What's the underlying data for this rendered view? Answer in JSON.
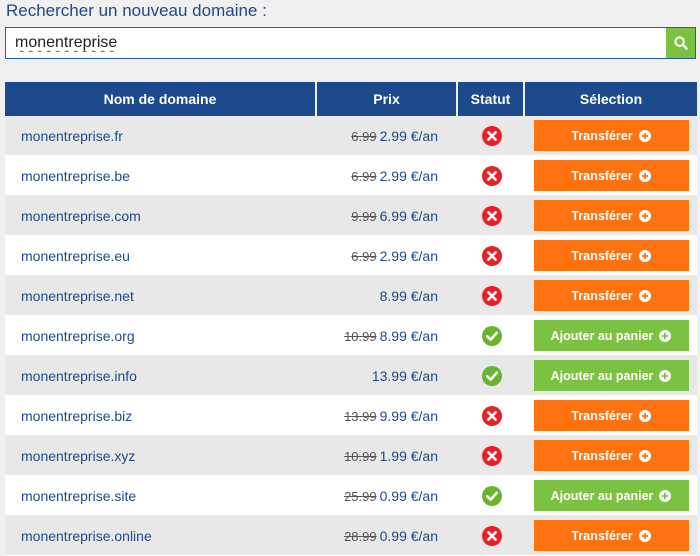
{
  "search": {
    "label": "Rechercher un nouveau domaine :",
    "value": "monentreprise",
    "button_icon": "search-icon"
  },
  "table": {
    "headers": [
      "Nom de domaine",
      "Prix",
      "Statut",
      "Sélection"
    ],
    "rows": [
      {
        "domain": "monentreprise.fr",
        "old_price": "6.99",
        "price": "2.99 €/an",
        "status": "unavailable",
        "action": "Transférer"
      },
      {
        "domain": "monentreprise.be",
        "old_price": "6.99",
        "price": "2.99 €/an",
        "status": "unavailable",
        "action": "Transférer"
      },
      {
        "domain": "monentreprise.com",
        "old_price": "9.99",
        "price": "6.99 €/an",
        "status": "unavailable",
        "action": "Transférer"
      },
      {
        "domain": "monentreprise.eu",
        "old_price": "6.99",
        "price": "2.99 €/an",
        "status": "unavailable",
        "action": "Transférer"
      },
      {
        "domain": "monentreprise.net",
        "old_price": "",
        "price": "8.99 €/an",
        "status": "unavailable",
        "action": "Transférer"
      },
      {
        "domain": "monentreprise.org",
        "old_price": "10.99",
        "price": "8.99 €/an",
        "status": "available",
        "action": "Ajouter au panier"
      },
      {
        "domain": "monentreprise.info",
        "old_price": "",
        "price": "13.99 €/an",
        "status": "available",
        "action": "Ajouter au panier"
      },
      {
        "domain": "monentreprise.biz",
        "old_price": "13.99",
        "price": "9.99 €/an",
        "status": "unavailable",
        "action": "Transférer"
      },
      {
        "domain": "monentreprise.xyz",
        "old_price": "10.99",
        "price": "1.99 €/an",
        "status": "unavailable",
        "action": "Transférer"
      },
      {
        "domain": "monentreprise.site",
        "old_price": "25.99",
        "price": "0.99 €/an",
        "status": "available",
        "action": "Ajouter au panier"
      },
      {
        "domain": "monentreprise.online",
        "old_price": "28.99",
        "price": "0.99 €/an",
        "status": "unavailable",
        "action": "Transférer"
      }
    ]
  },
  "colors": {
    "header_bg": "#1d4a8c",
    "transfer_button": "#ff7210",
    "add_button": "#7cc242",
    "unavailable_icon": "#e8202a",
    "available_icon": "#6ab42d"
  }
}
